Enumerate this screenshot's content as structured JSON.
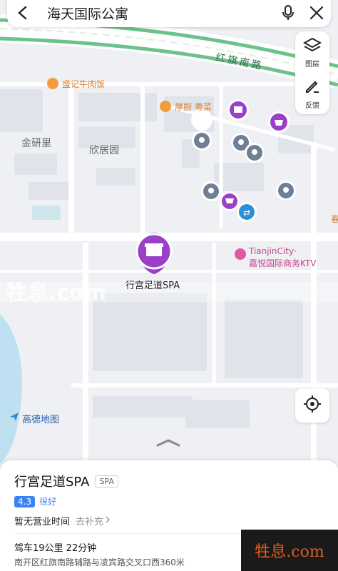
{
  "search": {
    "query": "海天国际公寓"
  },
  "tools": {
    "layers_label": "图层",
    "feedback_label": "反馈"
  },
  "map": {
    "road_label": "红旗南路",
    "areas": [
      "金研里",
      "欣居园"
    ],
    "pois": {
      "beef": "盛记牛肉饭",
      "restaurant": "厚厨 粤菜",
      "ktv_line1": "TianjinCity·",
      "ktv_line2": "嘉悦国际商务KTV",
      "edge_char": "春"
    },
    "selected_label": "行宫足道SPA",
    "provider": "高德地图",
    "watermark_ghost": "牲息.com",
    "colors": {
      "road_green": "#6bc28a",
      "poi_purple": "#9b3fc9",
      "pin_gray": "#6f7f95",
      "accent_blue": "#3b82f6"
    }
  },
  "sheet": {
    "title": "行宫足道SPA",
    "tag": "SPA",
    "score": "4.3",
    "score_text": "很好",
    "hours": "暂无营业时间",
    "supplement": "去补充",
    "drive": "驾车19公里 22分钟",
    "address": "南开区红旗南路辅路与凌宾路交叉口西360米"
  },
  "watermark": {
    "text": "牲息.com"
  }
}
